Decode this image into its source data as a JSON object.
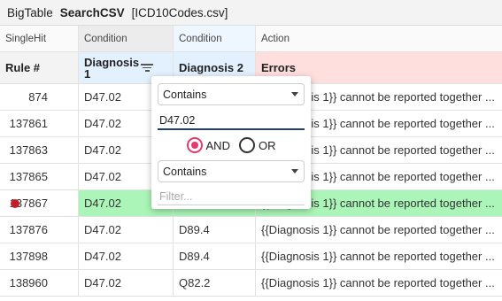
{
  "titlebar": {
    "app_name": "BigTable",
    "search_button": "SearchCSV",
    "file": "[ICD10Codes.csv]"
  },
  "header_types": [
    "SingleHit",
    "Condition",
    "Condition",
    "Action"
  ],
  "columns": {
    "rule": "Rule #",
    "dx1_line1": "Diagnosis",
    "dx1_line2": "1",
    "dx2": "Diagnosis 2",
    "errors": "Errors"
  },
  "rows": [
    {
      "rule": "874",
      "dx1": "D47.02",
      "dx2": "",
      "errors": "{{Diagnosis 1}} cannot be reported together ..."
    },
    {
      "rule": "137861",
      "dx1": "D47.02",
      "dx2": "",
      "errors": "{{Diagnosis 1}} cannot be reported together ..."
    },
    {
      "rule": "137863",
      "dx1": "D47.02",
      "dx2": "",
      "errors": "{{Diagnosis 1}} cannot be reported together ..."
    },
    {
      "rule": "137865",
      "dx1": "D47.02",
      "dx2": "",
      "errors": "{{Diagnosis 1}} cannot be reported together ..."
    },
    {
      "rule": "137867",
      "dx1": "D47.02",
      "dx2": "",
      "errors": "{{Diagnosis 1}} cannot be reported together ..."
    },
    {
      "rule": "137876",
      "dx1": "D47.02",
      "dx2": "D89.4",
      "errors": "{{Diagnosis 1}} cannot be reported together ..."
    },
    {
      "rule": "137898",
      "dx1": "D47.02",
      "dx2": "D89.4",
      "errors": "{{Diagnosis 1}} cannot be reported together ..."
    },
    {
      "rule": "138960",
      "dx1": "D47.02",
      "dx2": "Q82.2",
      "errors": "{{Diagnosis 1}} cannot be reported together ..."
    }
  ],
  "highlight": {
    "row_color": "#aaf5b7",
    "breakpoint_color": "#c0202a"
  },
  "filter_popup": {
    "operator1": "Contains",
    "value1": "D47.02",
    "and_label": "AND",
    "or_label": "OR",
    "selected_join": "AND",
    "operator2": "Contains",
    "value2_placeholder": "Filter...",
    "accent_color": "#e8386c"
  }
}
